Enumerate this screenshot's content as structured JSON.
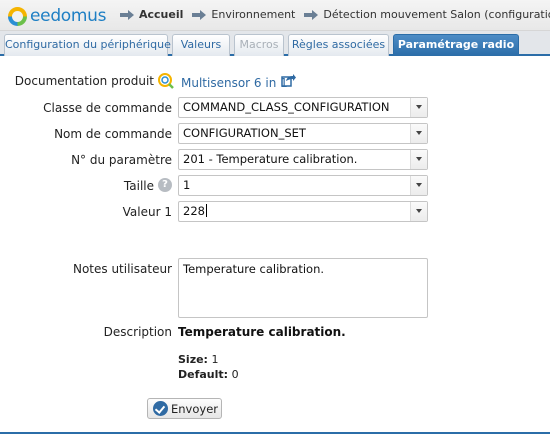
{
  "header": {
    "logo_text": "eedomus",
    "breadcrumbs": [
      "Accueil",
      "Environnement",
      "Détection mouvement Salon (configuration)"
    ]
  },
  "tabs": [
    {
      "label": "Configuration du périphérique",
      "state": "normal"
    },
    {
      "label": "Valeurs",
      "state": "normal"
    },
    {
      "label": "Macros",
      "state": "disabled"
    },
    {
      "label": "Règles associées",
      "state": "normal"
    },
    {
      "label": "Paramétrage radio",
      "state": "active"
    }
  ],
  "form": {
    "doc_label": "Documentation produit",
    "doc_link": "Multisensor 6 in 1",
    "command_class_label": "Classe de commande",
    "command_class_value": "COMMAND_CLASS_CONFIGURATION",
    "command_name_label": "Nom de commande",
    "command_name_value": "CONFIGURATION_SET",
    "param_label": "N° du paramètre",
    "param_value": "201 - Temperature calibration.",
    "size_label": "Taille",
    "size_value": "1",
    "value1_label": "Valeur 1",
    "value1_value": "228",
    "notes_label": "Notes utilisateur",
    "notes_value": "Temperature calibration.",
    "description_label": "Description",
    "description_value": "Temperature calibration.",
    "size_info_label": "Size:",
    "size_info_value": "1",
    "default_info_label": "Default:",
    "default_info_value": "0",
    "submit_label": "Envoyer"
  },
  "icons": {
    "logo": "eedomus-logo-icon",
    "breadcrumb_arrow": "arrow-right-icon",
    "doc": "documentation-search-icon",
    "external": "external-link-icon",
    "help": "help-icon",
    "submit": "check-icon",
    "select": "chevron-down-icon"
  },
  "colors": {
    "accent": "#2b6da8",
    "link": "#2f6aa3",
    "tab_disabled": "#a9b0b8"
  }
}
